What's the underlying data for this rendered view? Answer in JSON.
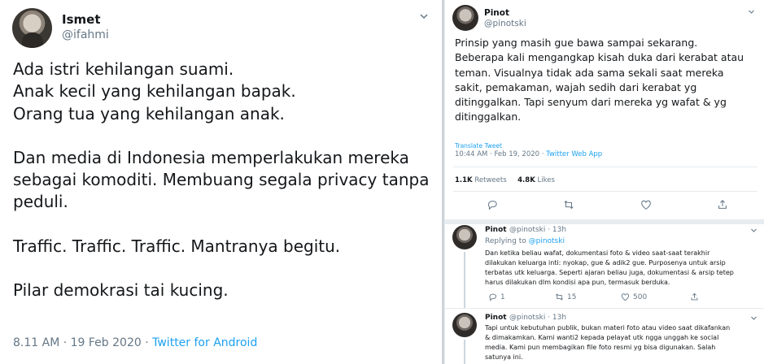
{
  "left_tweet": {
    "name": "Ismet",
    "handle": "@ifahmi",
    "lines": [
      "Ada istri kehilangan suami.",
      "Anak kecil yang kehilangan bapak.",
      "Orang tua yang kehilangan anak.",
      "",
      "Dan media di Indonesia memperlakukan mereka",
      "sebagai komoditi. Membuang segala privacy tanpa",
      "peduli.",
      "",
      "Traffic. Traffic. Traffic. Mantranya begitu.",
      "",
      "Pilar demokrasi tai kucing."
    ],
    "timestamp": "8.11 AM · 19 Feb 2020 · ",
    "source": "Twitter for Android"
  },
  "right_tweet": {
    "name": "Pinot",
    "handle": "@pinotski",
    "lines": [
      "Prinsip yang masih gue bawa sampai sekarang.",
      "Beberapa kali mengangkap kisah duka dari kerabat atau",
      "teman. Visualnya tidak ada sama sekali saat mereka",
      "sakit, pemakaman, wajah sedih dari kerabat yg",
      "ditinggalkan. Tapi senyum dari mereka yg wafat & yg",
      "ditinggalkan."
    ],
    "translate": "Translate Tweet",
    "timestamp": "10:44 AM · Feb 19, 2020 · ",
    "source": "Twitter Web App",
    "retweets_count": "1.1K",
    "retweets_label": " Retweets",
    "likes_count": "4.8K",
    "likes_label": " Likes"
  },
  "replies": [
    {
      "name": "Pinot",
      "handle": "@pinotski · 13h",
      "replying_prefix": "Replying to ",
      "replying_to": "@pinotski",
      "lines": [
        "Dan ketika beliau wafat, dokumentasi foto & video saat-saat terakhir",
        "dilakukan keluarga inti: nyokap, gue & adik2 gue. Purposenya untuk arsip",
        "terbatas utk keluarga. Seperti ajaran beliau juga, dokumentasi & arsip tetep",
        "harus dilakukan dlm kondisi apa pun, termasuk berduka."
      ],
      "replies_count": "1",
      "retweets_count": "15",
      "likes_count": "500"
    },
    {
      "name": "Pinot",
      "handle": "@pinotski · 13h",
      "lines": [
        "Tapi untuk kebutuhan publik, bukan materi foto atau video saat dikafankan",
        "& dimakamkan. Kami wanti2 kepada pelayat utk ngga unggah ke social",
        "media. Kami pun membagikan file foto resmi yg bisa digunakan. Salah",
        "satunya ini."
      ]
    }
  ],
  "colors": {
    "text": "#14171a",
    "secondary": "#657786",
    "link": "#1da1f2",
    "border": "#e6ecf0"
  },
  "icons": [
    "chevron-down-icon",
    "reply-icon",
    "retweet-icon",
    "like-icon",
    "share-icon"
  ]
}
